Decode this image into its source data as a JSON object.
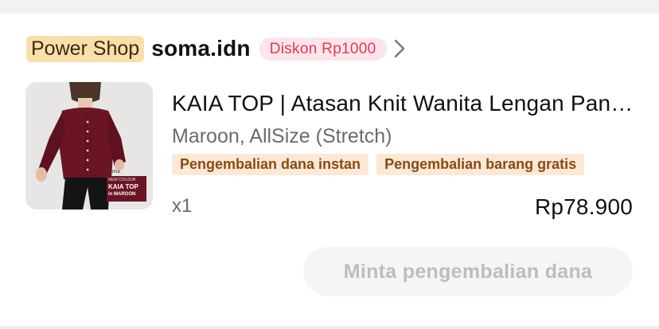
{
  "shop": {
    "badge": "Power Shop",
    "name": "soma.idn",
    "discount": "Diskon Rp1000",
    "chevron_icon": "chevron-right-icon"
  },
  "product": {
    "title": "KAIA TOP | Atasan Knit Wanita Lengan Panjang",
    "variant": "Maroon, AllSize (Stretch)",
    "tags": [
      "Pengembalian dana instan",
      "Pengembalian barang gratis"
    ],
    "quantity": "x1",
    "price": "Rp78.900",
    "image": {
      "brand": "soma",
      "line1": "NEW COLOUR",
      "line2": "KAIA TOP",
      "line3": "in MAROON"
    }
  },
  "actions": {
    "refund_label": "Minta pengembalian dana"
  },
  "colors": {
    "discount_text": "#e8345c",
    "tag_text": "#8a4b12",
    "power_badge_bg": "#fbdfa9",
    "garment": "#6b1424"
  }
}
